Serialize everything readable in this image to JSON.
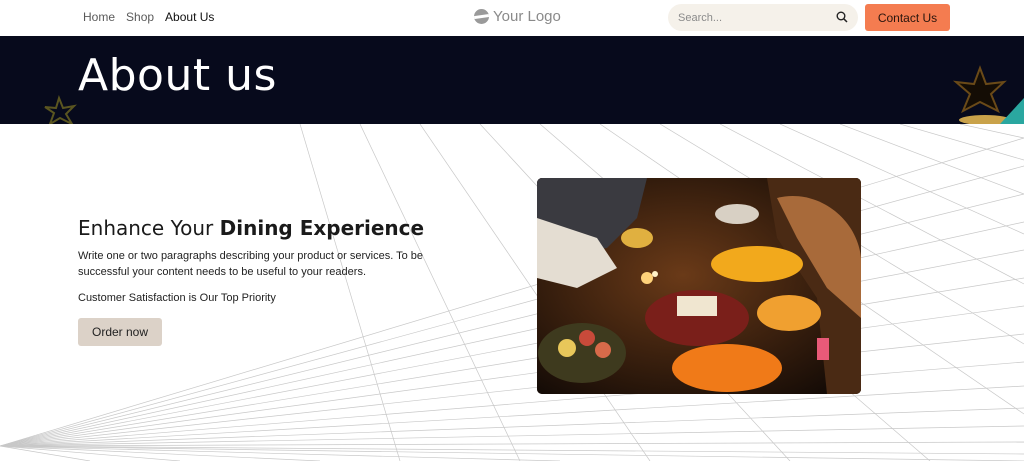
{
  "nav": {
    "items": [
      "Home",
      "Shop",
      "About Us"
    ],
    "active_index": 2
  },
  "logo": {
    "text": "Your Logo"
  },
  "search": {
    "placeholder": "Search..."
  },
  "header": {
    "contact_label": "Contact Us"
  },
  "hero": {
    "title": "About us"
  },
  "main": {
    "heading_light": "Enhance Your ",
    "heading_bold": "Dining Experience",
    "paragraph": "Write one or two paragraphs describing your product or services. To be successful your content needs to be useful to your readers.",
    "tagline": "Customer Satisfaction is Our Top Priority",
    "order_label": "Order now"
  },
  "colors": {
    "accent": "#f47c50",
    "hero_bg": "#070a1c",
    "secondary_button": "#dcd2c8",
    "search_bg": "#f5f1ea"
  },
  "icons": {
    "search": "search-icon",
    "logo": "logo-icon"
  }
}
